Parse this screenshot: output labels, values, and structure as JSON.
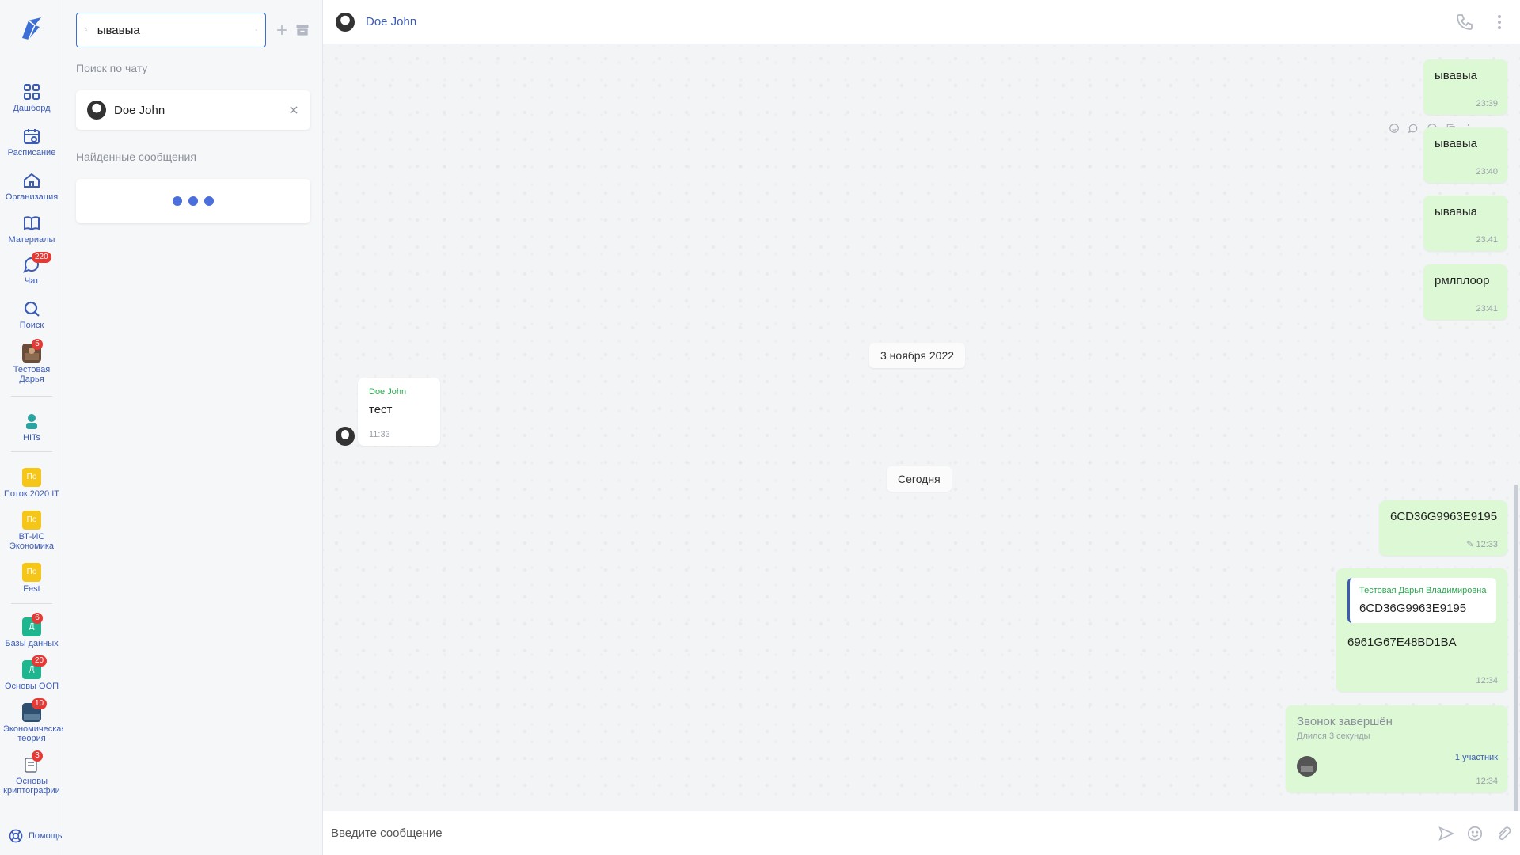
{
  "nav": {
    "dashboard": "Дашборд",
    "schedule": "Расписание",
    "organization": "Организация",
    "materials": "Материалы",
    "chat": "Чат",
    "chat_badge": "220",
    "search": "Поиск",
    "test_user": "Тестовая Дарья",
    "test_user_badge": "5",
    "hits": "HITs",
    "groups": [
      {
        "abbr": "По",
        "label": "Поток 2020 IT"
      },
      {
        "abbr": "По",
        "label": "ВТ-ИС Экономика"
      },
      {
        "abbr": "По",
        "label": "Fest"
      }
    ],
    "courses": [
      {
        "abbr": "Д",
        "label": "Базы данных",
        "badge": "6"
      },
      {
        "abbr": "Д",
        "label": "Основы ООП",
        "badge": "20"
      },
      {
        "abbr": "",
        "label": "Экономическая теория",
        "badge": "10"
      },
      {
        "abbr": "",
        "label": "Основы криптографии",
        "badge": "3"
      }
    ],
    "help": "Помощь"
  },
  "search_panel": {
    "query": "ывавыа",
    "chat_search_label": "Поиск по чату",
    "chat_result_name": "Doe John",
    "found_messages_label": "Найденные сообщения"
  },
  "chat": {
    "contact_name": "Doe John",
    "messages": [
      {
        "text": "ывавыа",
        "time": "23:39"
      },
      {
        "text": "ывавыа",
        "time": "23:40"
      },
      {
        "text": "ывавыа",
        "time": "23:41"
      },
      {
        "text": "рмлплоор",
        "time": "23:41"
      }
    ],
    "date_1": "3 ноября 2022",
    "incoming": {
      "sender": "Doe John",
      "text": "тест",
      "time": "11:33"
    },
    "date_2": "Сегодня",
    "edited": {
      "text": "6CD36G9963E9195",
      "time": "12:33"
    },
    "reply": {
      "quote_name": "Тестовая Дарья Владимировна",
      "quote_text": "6CD36G9963E9195",
      "text": "6961G67E48BD1BA",
      "time": "12:34"
    },
    "call": {
      "title": "Звонок завершён",
      "duration": "Длился 3 секунды",
      "participants": "1 участник",
      "time": "12:34"
    },
    "composer_placeholder": "Введите сообщение"
  },
  "colors": {
    "accent": "#3b5bb5",
    "outgoing_bubble": "#dcf8d4",
    "badge": "#e53935",
    "sender": "#2aa84f"
  }
}
